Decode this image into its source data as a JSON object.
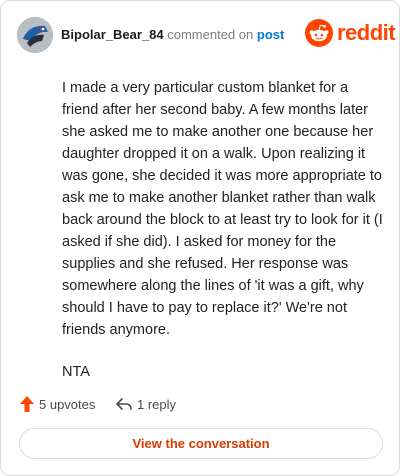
{
  "comment": {
    "username": "Bipolar_Bear_84",
    "commented_on": "commented on",
    "post_link": "post",
    "paragraphs": [
      "I made a very particular custom blanket for a friend after her second baby. A few months later she asked me to make another one because her daughter dropped it on a walk. Upon realizing it was gone, she decided it was more appropriate to ask me to make another blanket rather than walk back around the block to at least try to look for it (I asked if she did). I asked for money for the supplies and she refused. Her response was somewhere along the lines of 'it was a gift, why should I have to pay to replace it?' We're not friends anymore.",
      "NTA"
    ]
  },
  "brand": {
    "wordmark": "reddit",
    "accent_color": "#ff4500",
    "icon": "reddit-snoo-icon"
  },
  "actions": {
    "upvotes_label": "5 upvotes",
    "replies_label": "1 reply",
    "upvote_icon": "upvote-arrow-icon",
    "reply_icon": "reply-arrow-icon"
  },
  "cta": {
    "label": "View the conversation",
    "color": "#d93a00"
  },
  "colors": {
    "link": "#0079d3",
    "muted": "#7c7c7c",
    "border": "#dcdcdc"
  }
}
